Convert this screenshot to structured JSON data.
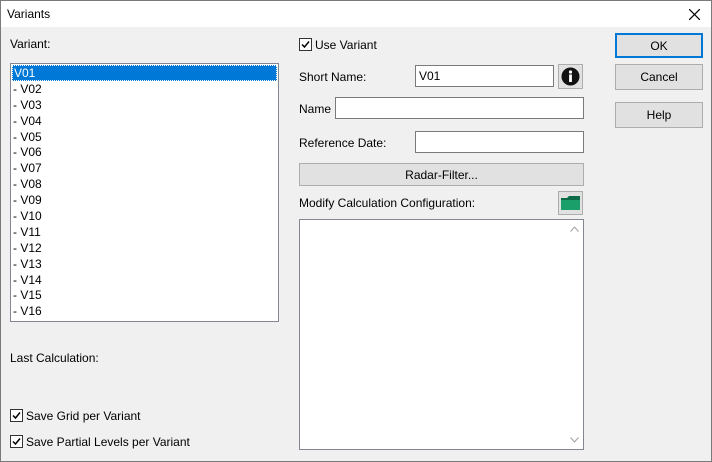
{
  "window": {
    "title": "Variants"
  },
  "variant_list": {
    "label": "Variant:",
    "items": [
      " V01",
      "- V02",
      "- V03",
      "- V04",
      "- V05",
      "- V06",
      "- V07",
      "- V08",
      "- V09",
      "- V10",
      "- V11",
      "- V12",
      "- V13",
      "- V14",
      "- V15",
      "- V16"
    ],
    "selected": " V01"
  },
  "last_calculation": {
    "label": "Last Calculation:"
  },
  "options": {
    "save_grid": {
      "label": "Save Grid per Variant",
      "checked": true
    },
    "save_partial": {
      "label": "Save Partial Levels per Variant",
      "checked": true
    }
  },
  "use_variant": {
    "label": "Use Variant",
    "checked": true
  },
  "short_name": {
    "label": "Short Name:",
    "value": "V01"
  },
  "name": {
    "label": "Name",
    "value": ""
  },
  "reference_date": {
    "label": "Reference Date:",
    "value": ""
  },
  "radar_filter": {
    "label": "Radar-Filter..."
  },
  "modify_calc": {
    "label": "Modify Calculation Configuration:",
    "value": ""
  },
  "buttons": {
    "ok": "OK",
    "cancel": "Cancel",
    "help": "Help"
  },
  "icons": {
    "info": "info-icon",
    "folder": "folder-icon",
    "close": "close-icon"
  },
  "colors": {
    "selection": "#0078d7",
    "folder": "#1a9e6a"
  }
}
